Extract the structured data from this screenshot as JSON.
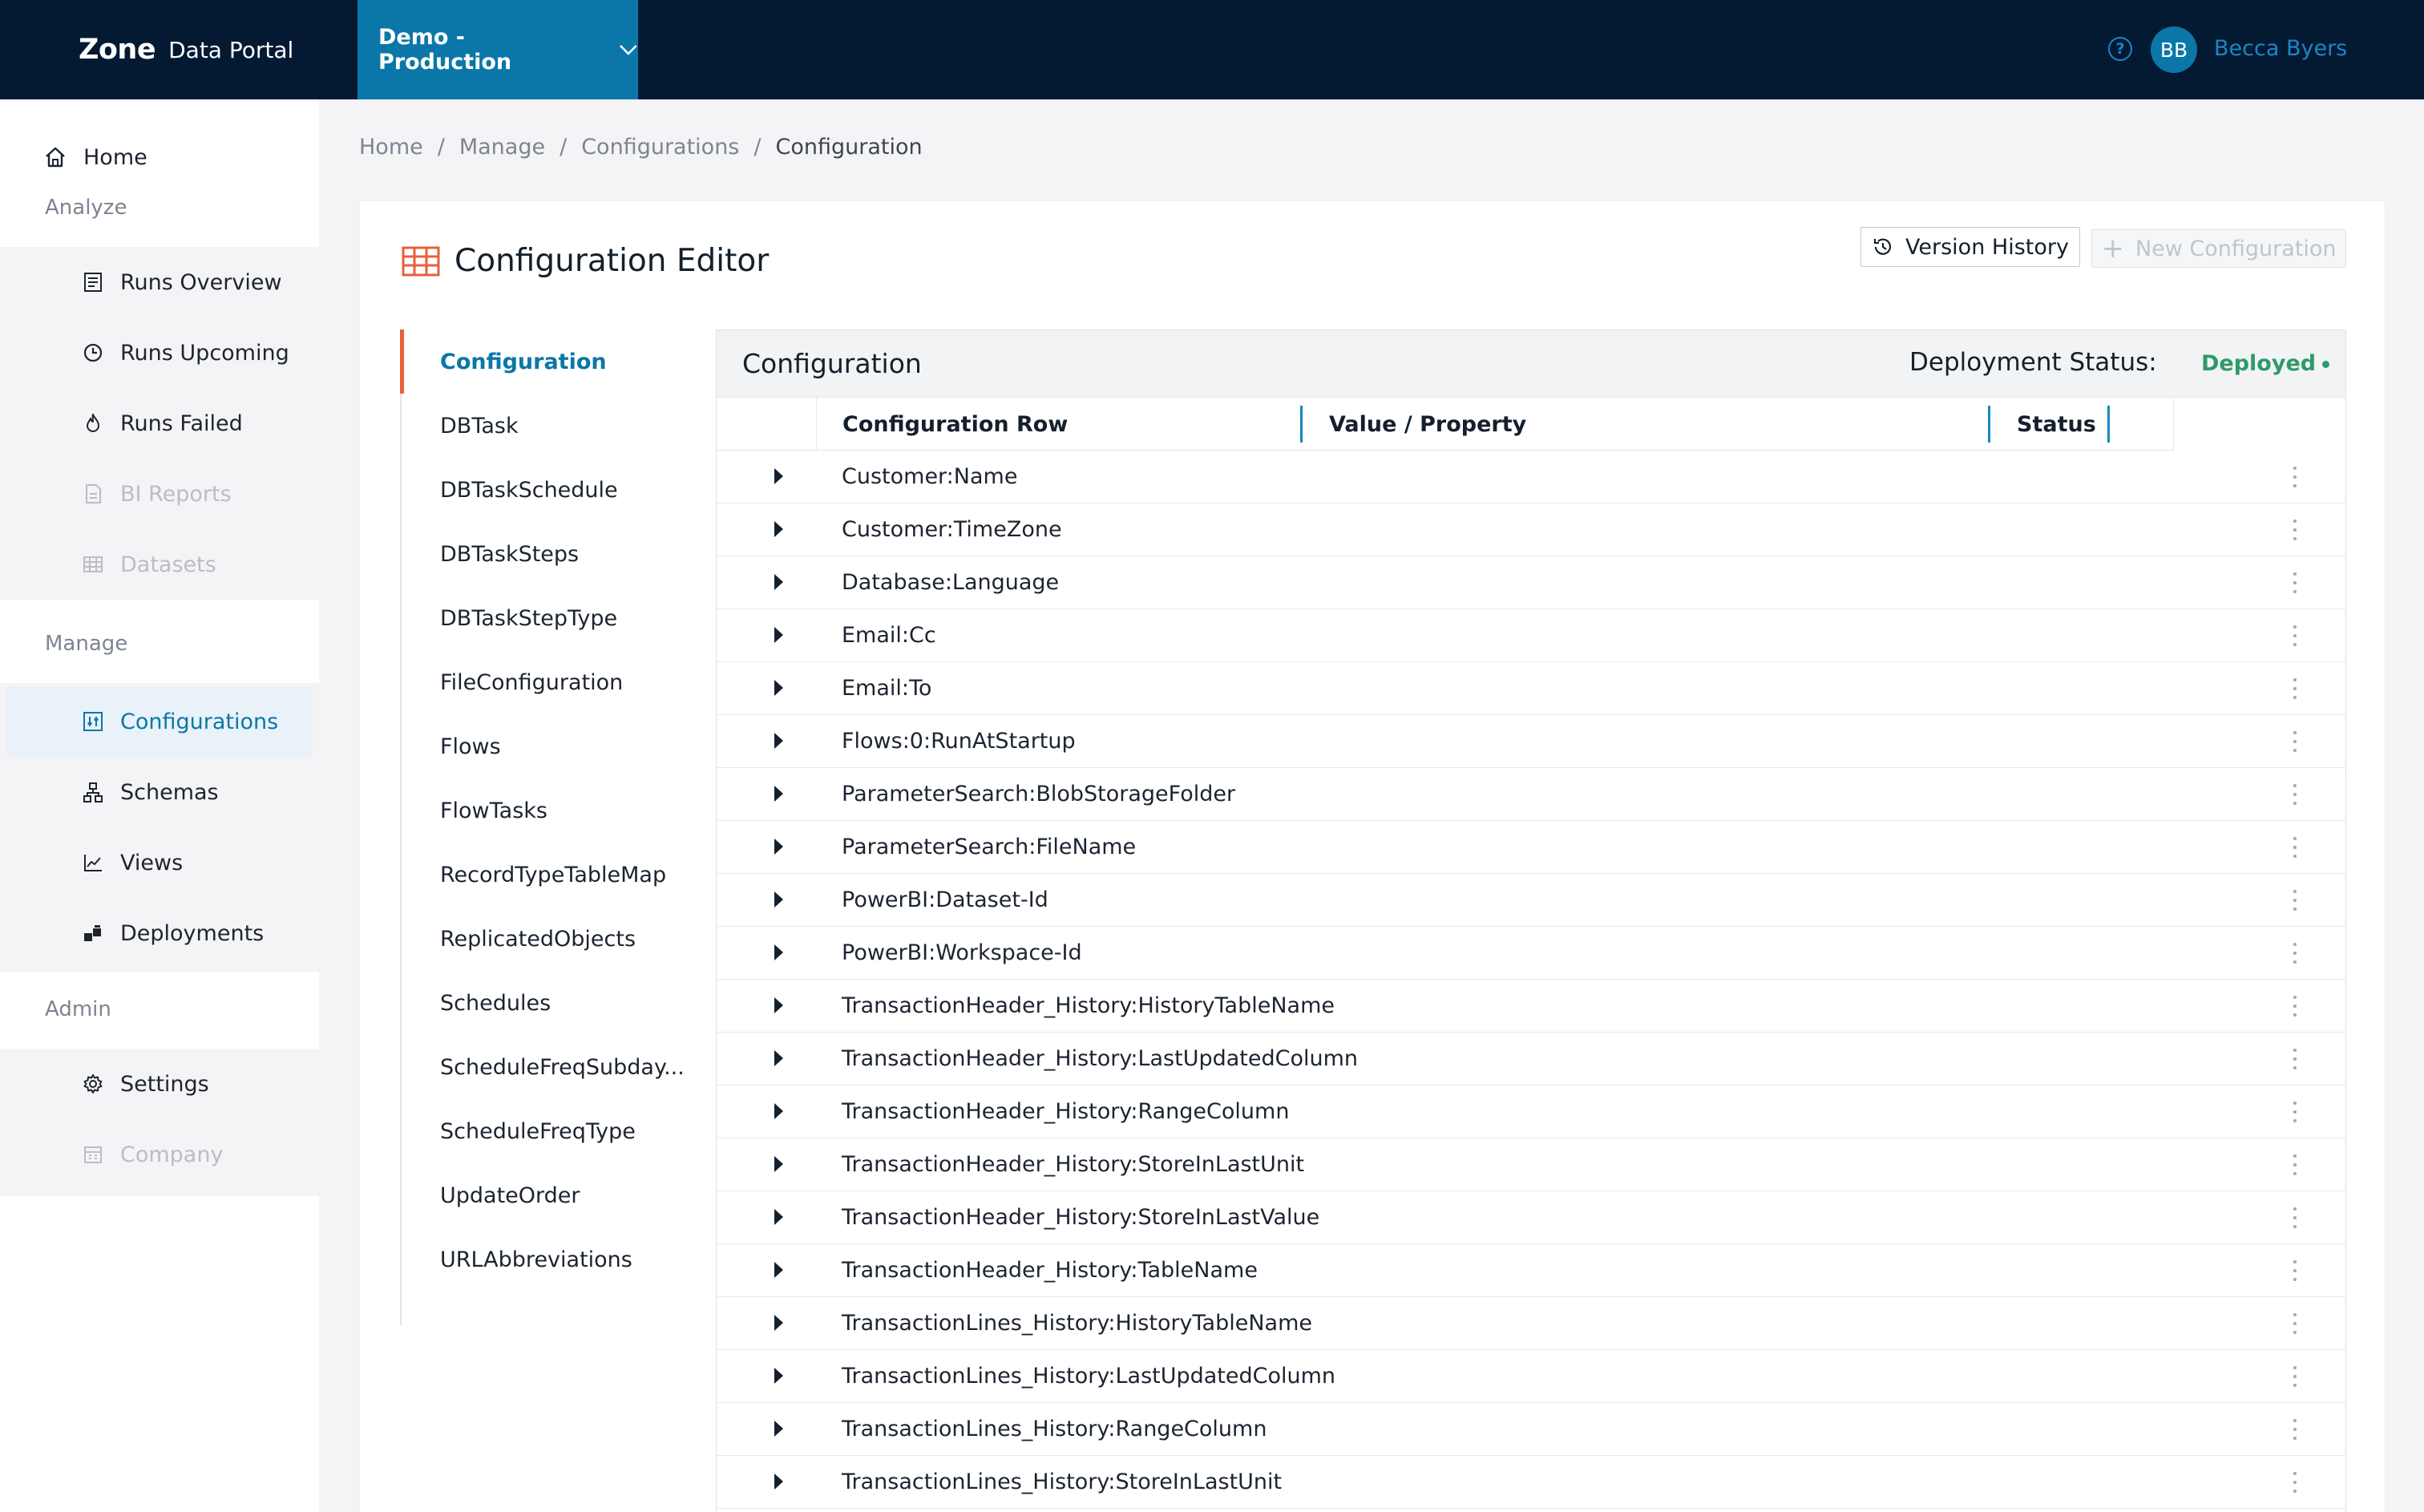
{
  "topbar": {
    "logo_bold": "Zone",
    "logo_light": "Data Portal",
    "environment": "Demo - Production",
    "help_icon": "?",
    "avatar_initials": "BB",
    "user_name": "Becca Byers"
  },
  "sidebar": {
    "home": "Home",
    "sections": {
      "analyze": "Analyze",
      "manage": "Manage",
      "admin": "Admin"
    },
    "analyze_items": [
      {
        "label": "Runs Overview",
        "icon": "list-icon",
        "disabled": false
      },
      {
        "label": "Runs Upcoming",
        "icon": "clock-icon",
        "disabled": false
      },
      {
        "label": "Runs Failed",
        "icon": "flame-icon",
        "disabled": false
      },
      {
        "label": "BI Reports",
        "icon": "report-icon",
        "disabled": true
      },
      {
        "label": "Datasets",
        "icon": "grid-icon",
        "disabled": true
      }
    ],
    "manage_items": [
      {
        "label": "Configurations",
        "icon": "sliders-icon",
        "active": true
      },
      {
        "label": "Schemas",
        "icon": "hierarchy-icon",
        "active": false
      },
      {
        "label": "Views",
        "icon": "line-chart-icon",
        "active": false
      },
      {
        "label": "Deployments",
        "icon": "blocks-icon",
        "active": false
      }
    ],
    "admin_items": [
      {
        "label": "Settings",
        "icon": "gear-icon",
        "disabled": false
      },
      {
        "label": "Company",
        "icon": "building-icon",
        "disabled": true
      }
    ]
  },
  "breadcrumb": {
    "items": [
      "Home",
      "Manage",
      "Configurations"
    ],
    "separator": "/",
    "current": "Configuration"
  },
  "editor": {
    "title": "Configuration Editor",
    "version_history": "Version History",
    "new_configuration": "New Configuration"
  },
  "config_nav": [
    "Configuration",
    "DBTask",
    "DBTaskSchedule",
    "DBTaskSteps",
    "DBTaskStepType",
    "FileConfiguration",
    "Flows",
    "FlowTasks",
    "RecordTypeTableMap",
    "ReplicatedObjects",
    "Schedules",
    "ScheduleFreqSubday...",
    "ScheduleFreqType",
    "UpdateOrder",
    "URLAbbreviations"
  ],
  "table": {
    "title": "Configuration",
    "deployment_label": "Deployment Status:",
    "deployment_value": "Deployed",
    "deployment_color": "#2e9a6a",
    "columns": [
      "Configuration Row",
      "Value / Property",
      "Status"
    ],
    "rows": [
      "Customer:Name",
      "Customer:TimeZone",
      "Database:Language",
      "Email:Cc",
      "Email:To",
      "Flows:0:RunAtStartup",
      "ParameterSearch:BlobStorageFolder",
      "ParameterSearch:FileName",
      "PowerBI:Dataset-Id",
      "PowerBI:Workspace-Id",
      "TransactionHeader_History:HistoryTableName",
      "TransactionHeader_History:LastUpdatedColumn",
      "TransactionHeader_History:RangeColumn",
      "TransactionHeader_History:StoreInLastUnit",
      "TransactionHeader_History:StoreInLastValue",
      "TransactionHeader_History:TableName",
      "TransactionLines_History:HistoryTableName",
      "TransactionLines_History:LastUpdatedColumn",
      "TransactionLines_History:RangeColumn",
      "TransactionLines_History:StoreInLastUnit"
    ]
  },
  "colors": {
    "topbar": "#041a33",
    "accent": "#0b77a8",
    "active_marker": "#e8603c"
  }
}
